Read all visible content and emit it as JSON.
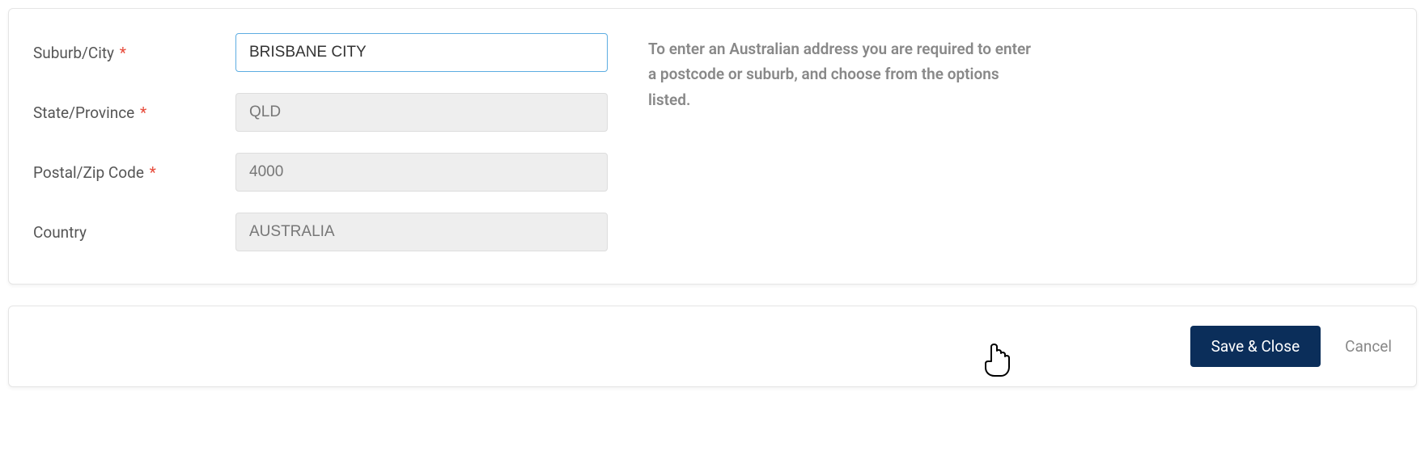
{
  "fields": {
    "suburb": {
      "label": "Suburb/City",
      "value": "BRISBANE CITY",
      "required": true
    },
    "state": {
      "label": "State/Province",
      "value": "QLD",
      "required": true
    },
    "postal": {
      "label": "Postal/Zip Code",
      "value": "4000",
      "required": true
    },
    "country": {
      "label": "Country",
      "value": "AUSTRALIA",
      "required": false
    }
  },
  "required_marker": "*",
  "help": "To enter an Australian address you are required to enter a postcode or suburb, and choose from the options listed.",
  "actions": {
    "save": "Save & Close",
    "cancel": "Cancel"
  }
}
